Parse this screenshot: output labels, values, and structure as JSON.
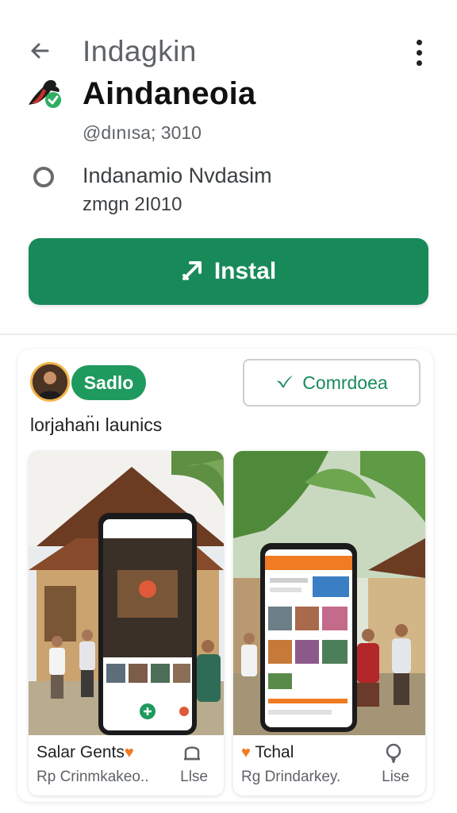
{
  "header": {
    "title": "Indagkin",
    "back_icon": "back-arrow-icon",
    "menu_icon": "more-vert-icon"
  },
  "app": {
    "name": "Aindaneoia",
    "handle": "@dınısa; 3010",
    "icon": "app-logo-icon",
    "verified_color": "#2fae62"
  },
  "developer": {
    "name": "Indanamio Nvdasim",
    "sub": "zmgn 2I010"
  },
  "install": {
    "label": "Instal",
    "icon": "install-arrow-icon",
    "color": "#188a5a"
  },
  "promo": {
    "badge": "Sadlo",
    "button_label": "Comrdoea",
    "button_icon": "check-icon",
    "section_title": "lorjahan̈ı launics",
    "tiles": [
      {
        "name": "Salar Gents",
        "name_icon": "heart-icon",
        "sub": "Rp Crinmkakeo..",
        "action_icon": "bag-icon",
        "action_label": "Llse"
      },
      {
        "name": "Tchal",
        "name_icon": "heart-icon",
        "sub": "Rg Drindarkey.",
        "action_icon": "message-icon",
        "action_label": "Lise"
      }
    ]
  }
}
